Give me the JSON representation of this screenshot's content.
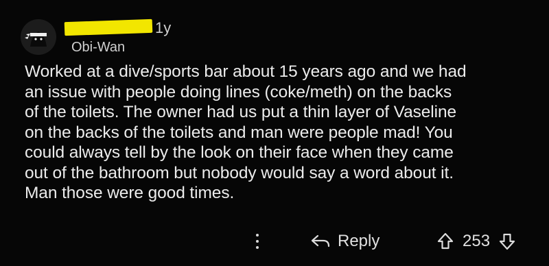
{
  "comment": {
    "age": "1y",
    "flair": "Obi-Wan",
    "body_lines": [
      "Worked at a dive/sports bar about 15 years ago and we had",
      "an issue with people doing lines (coke/meth) on the backs",
      "of the toilets. The owner had us put a thin layer of Vaseline",
      "on the backs of the toilets and man were people mad! You",
      "could always tell by the look on their face when they came",
      "out of the bathroom but nobody would say a word about it.",
      "Man those were good times."
    ]
  },
  "actions": {
    "more_icon": "vertical-ellipsis-icon",
    "reply_icon": "reply-arrow-icon",
    "reply_label": "Reply",
    "upvote_icon": "upvote-arrow-icon",
    "downvote_icon": "downvote-arrow-icon",
    "score": "253"
  },
  "colors": {
    "background": "#060606",
    "redaction": "#f2e600",
    "text": "#ececec"
  }
}
